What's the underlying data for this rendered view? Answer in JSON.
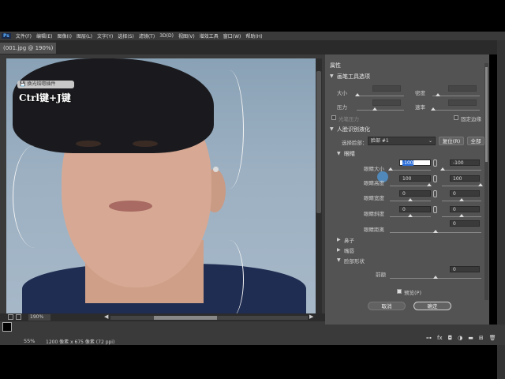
{
  "menu": {
    "app_badge": "Ps",
    "items": [
      "文件(F)",
      "编辑(E)",
      "图像(I)",
      "图层(L)",
      "文字(Y)",
      "选择(S)",
      "滤镜(T)",
      "3D(D)",
      "视图(V)",
      "增效工具",
      "窗口(W)",
      "帮助(H)"
    ]
  },
  "document": {
    "tab_title": "(001.jpg @ 190%)"
  },
  "canvas": {
    "plugin_badge": "💾 换光焙唿插件",
    "shortcut_overlay": "Ctrl键+J键",
    "zoom_value": "190%"
  },
  "panel": {
    "title": "属性",
    "brush_section": {
      "title": "画笔工具选项",
      "size_label": "大小",
      "density_label": "密度",
      "pressure_label": "压力",
      "rate_label": "速率",
      "stylus_label": "光笔压力",
      "pin_edges_label": "固定边缘"
    },
    "face_section": {
      "title": "人脸识别液化",
      "select_face_label": "选择脸部：",
      "face_selected": "脸部 #1",
      "reset_button": "复位(R)",
      "all_button": "全部",
      "eyes": {
        "title": "眼睛",
        "rows": [
          {
            "label": "眼睛大小",
            "left": "-100",
            "right": "-100"
          },
          {
            "label": "眼睛高度",
            "left": "100",
            "right": "100"
          },
          {
            "label": "眼睛宽度",
            "left": "0",
            "right": "0"
          },
          {
            "label": "眼睛斜度",
            "left": "0",
            "right": "0"
          },
          {
            "label": "眼睛距离",
            "value": "0"
          }
        ]
      },
      "nose_label": "鼻子",
      "mouth_label": "嘴唇",
      "face_shape_label": "脸部形状",
      "forehead_label": "前额",
      "forehead_value": "0"
    },
    "preview_label": "预览(P)",
    "cancel_button": "取消",
    "ok_button": "确定"
  },
  "status": {
    "zoom": "55%",
    "doc_info": "1200 像素 x 675 像素 (72 ppi)"
  },
  "colors": {
    "accent": "#2a6edb",
    "panel_bg": "#535353",
    "canvas_bg": "#3a3a3a"
  }
}
